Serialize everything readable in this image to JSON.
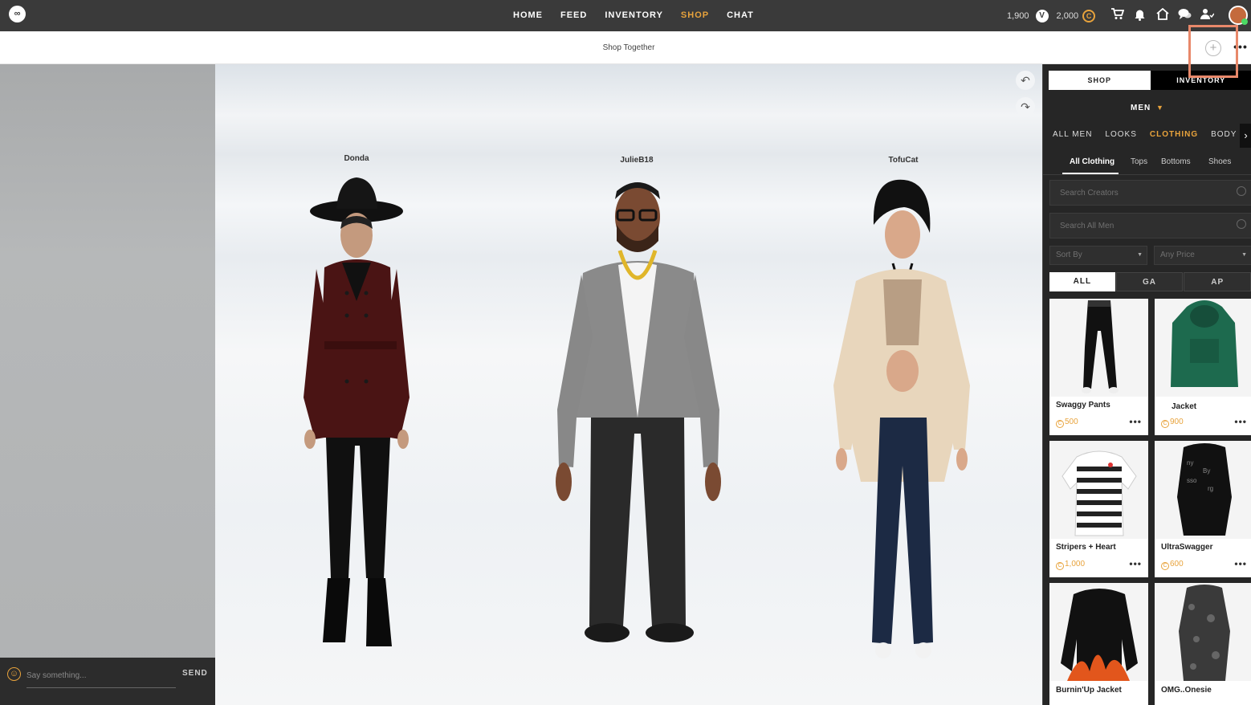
{
  "topnav": {
    "logo": "∞",
    "links": [
      "HOME",
      "FEED",
      "INVENTORY",
      "SHOP",
      "CHAT"
    ],
    "active": "SHOP",
    "vip_credits": "1,900",
    "credits": "2,000",
    "vip_icon_glyph": "V",
    "credit_icon_glyph": "C",
    "icons": [
      "cart-icon",
      "bell-icon",
      "home-icon",
      "chat-bubbles-icon",
      "friends-icon"
    ]
  },
  "subbar": {
    "title": "Shop Together",
    "add_glyph": "+",
    "more_glyph": "•••"
  },
  "chat": {
    "placeholder": "Say something...",
    "send_label": "SEND",
    "emoji_glyph": "☺"
  },
  "stage": {
    "undo_glyph": "↶",
    "redo_glyph": "↷",
    "characters": [
      {
        "name": "Donda"
      },
      {
        "name": "JulieB18"
      },
      {
        "name": "TofuCat"
      }
    ]
  },
  "shop_panel": {
    "tabs": [
      "SHOP",
      "INVENTORY"
    ],
    "gender": "MEN",
    "gender_caret": "▼",
    "categories": [
      "ALL MEN",
      "LOOKS",
      "CLOTHING",
      "BODY"
    ],
    "active_category": "CLOTHING",
    "category_arrow": "›",
    "subcategories": [
      "All Clothing",
      "Tops",
      "Bottoms",
      "Shoes"
    ],
    "active_subcategory": "All Clothing",
    "search_creators_placeholder": "Search Creators",
    "search_all_placeholder": "Search All Men",
    "sort_by": "Sort By",
    "any_price": "Any Price",
    "dropdown_caret": "▼",
    "filters": [
      "ALL",
      "GA",
      "AP"
    ],
    "active_filter": "ALL",
    "coin_glyph": "C",
    "dots_glyph": "•••",
    "items": [
      {
        "name": "Swaggy Pants",
        "price": "500"
      },
      {
        "name": "Jacket",
        "price": "900"
      },
      {
        "name": "Stripers + Heart",
        "price": "1,000"
      },
      {
        "name": "UltraSwagger",
        "price": "600"
      },
      {
        "name": "Burnin'Up Jacket",
        "price": ""
      },
      {
        "name": "OMG..Onesie",
        "price": ""
      }
    ]
  },
  "colors": {
    "accent": "#e8a33c",
    "nav_bg": "#3a3a3a",
    "panel_bg": "#262626",
    "highlight": "#e8886a"
  }
}
